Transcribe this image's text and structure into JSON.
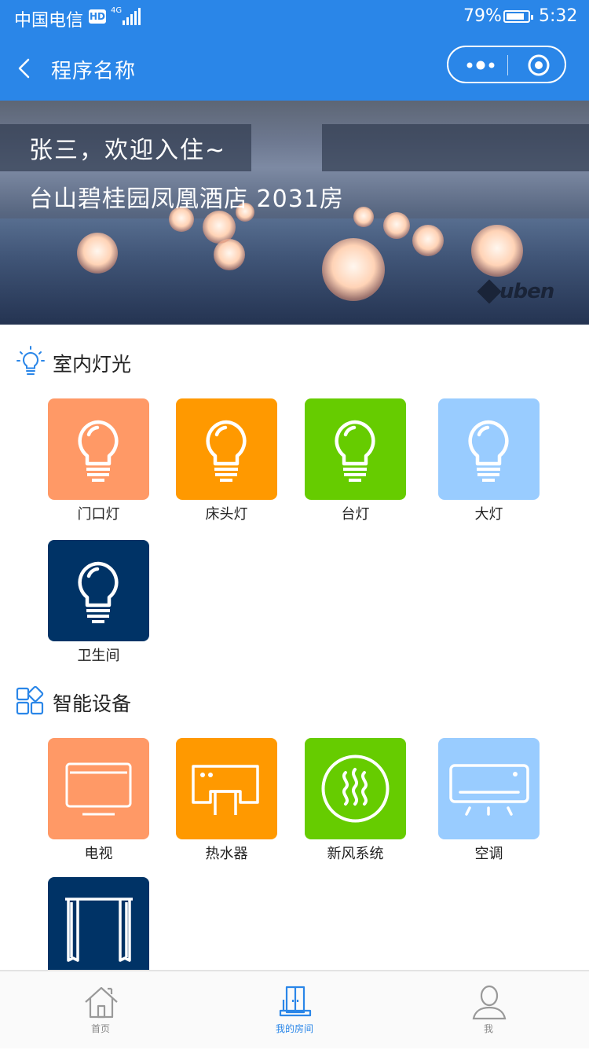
{
  "status_bar": {
    "carrier": "中国电信",
    "hd": "HD",
    "network": "4G",
    "battery": "79%",
    "battery_level": 0.79,
    "time": "5:32"
  },
  "nav": {
    "title": "程序名称"
  },
  "banner": {
    "greeting": "张三，欢迎入住~",
    "hotel_room": "台山碧桂园凤凰酒店  2031房",
    "logo": "uben"
  },
  "lights": {
    "title": "室内灯光",
    "items": [
      {
        "label": "门口灯",
        "color": "#ff9966",
        "icon": "bulb-icon"
      },
      {
        "label": "床头灯",
        "color": "#ff9900",
        "icon": "bulb-icon"
      },
      {
        "label": "台灯",
        "color": "#66cc00",
        "icon": "bulb-icon"
      },
      {
        "label": "大灯",
        "color": "#99ccff",
        "icon": "bulb-icon"
      },
      {
        "label": "卫生间",
        "color": "#003366",
        "icon": "bulb-icon"
      }
    ]
  },
  "devices": {
    "title": "智能设备",
    "items": [
      {
        "label": "电视",
        "color": "#ff9966",
        "icon": "tv-icon"
      },
      {
        "label": "热水器",
        "color": "#ff9900",
        "icon": "water-heater-icon"
      },
      {
        "label": "新风系统",
        "color": "#66cc00",
        "icon": "fresh-air-icon"
      },
      {
        "label": "空调",
        "color": "#99ccff",
        "icon": "air-conditioner-icon"
      },
      {
        "label": "",
        "color": "#003366",
        "icon": "curtain-icon"
      }
    ]
  },
  "tabbar": {
    "items": [
      {
        "label": "首页",
        "icon": "home-icon",
        "active": false
      },
      {
        "label": "我的房间",
        "icon": "room-door-icon",
        "active": true
      },
      {
        "label": "我",
        "icon": "user-icon",
        "active": false
      }
    ]
  },
  "colors": {
    "primary": "#2a86e8",
    "inactive": "#888888"
  }
}
